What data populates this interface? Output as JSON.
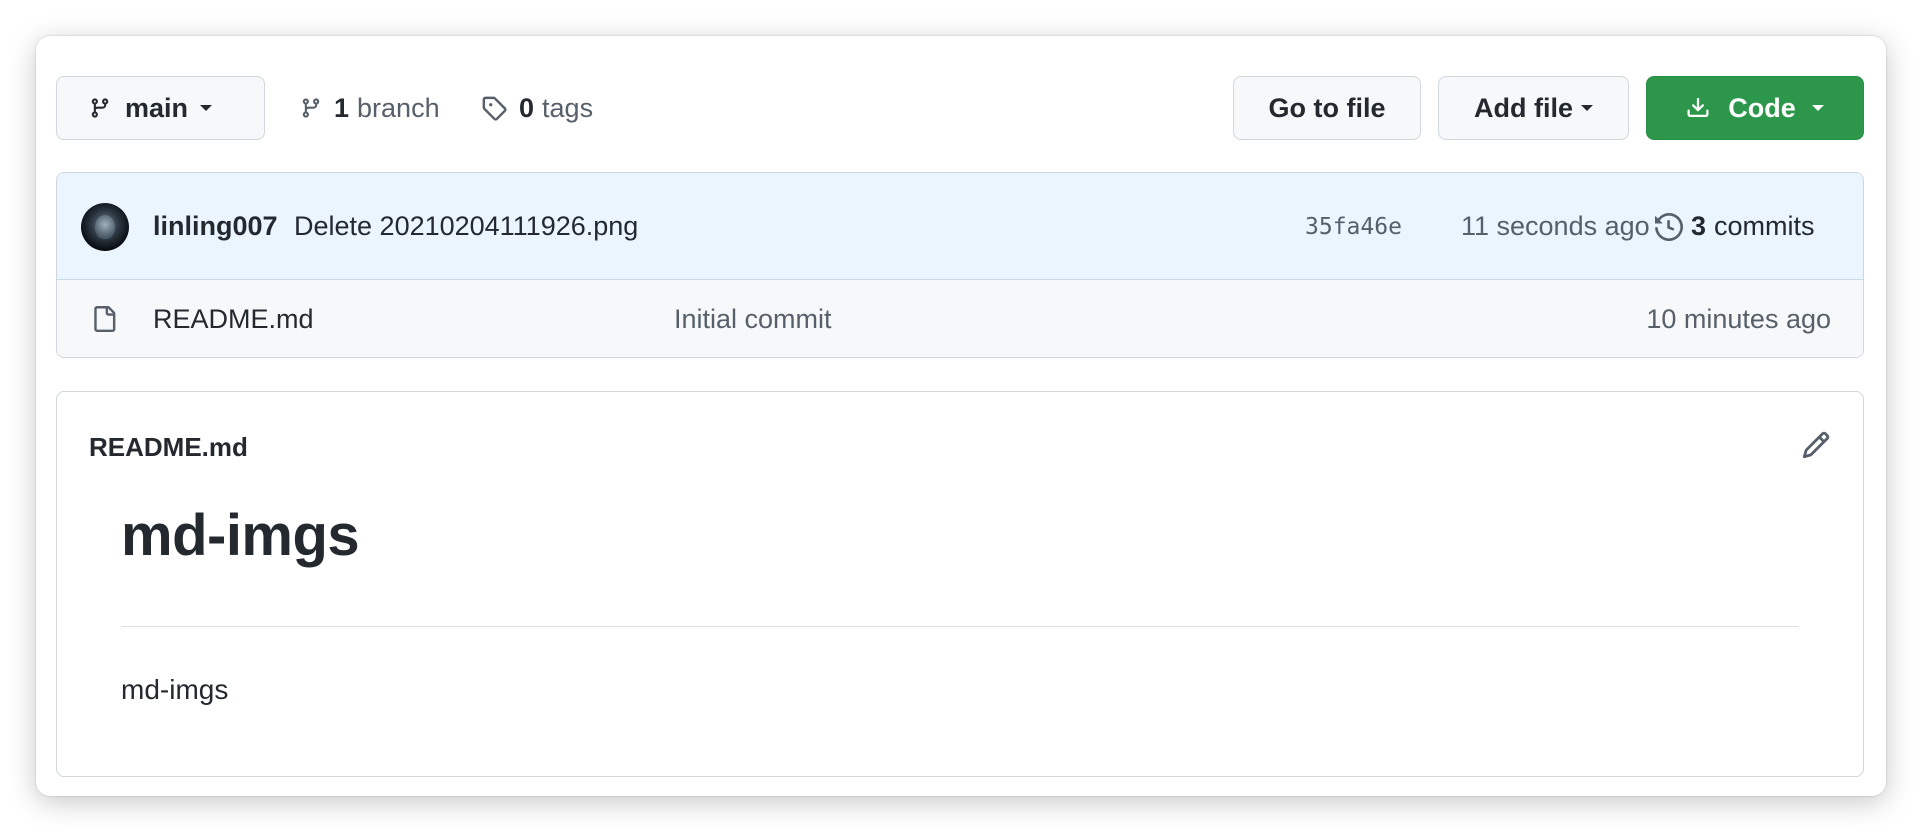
{
  "toolbar": {
    "branch_name": "main",
    "branch_count": "1",
    "branch_word": "branch",
    "tag_count": "0",
    "tag_word": "tags",
    "goto_label": "Go to file",
    "add_file_label": "Add file",
    "code_label": "Code"
  },
  "latest_commit": {
    "author": "linling007",
    "message": "Delete 20210204111926.png",
    "sha": "35fa46e",
    "time": "11 seconds ago",
    "commit_count": "3",
    "commit_word": "commits"
  },
  "files": [
    {
      "name": "README.md",
      "commit_message": "Initial commit",
      "time": "10 minutes ago",
      "icon": "file-icon"
    }
  ],
  "readme": {
    "filename": "README.md",
    "heading": "md-imgs",
    "body": "md-imgs"
  },
  "colors": {
    "code_button": "#2c974b",
    "commit_row_bg": "#eaf5ff",
    "file_row_bg": "#f6f8fa",
    "border": "#d0d7de",
    "muted_text": "#57606a"
  },
  "icons": [
    "git-branch-icon",
    "tag-icon",
    "download-icon",
    "history-icon",
    "file-icon",
    "pencil-icon"
  ]
}
